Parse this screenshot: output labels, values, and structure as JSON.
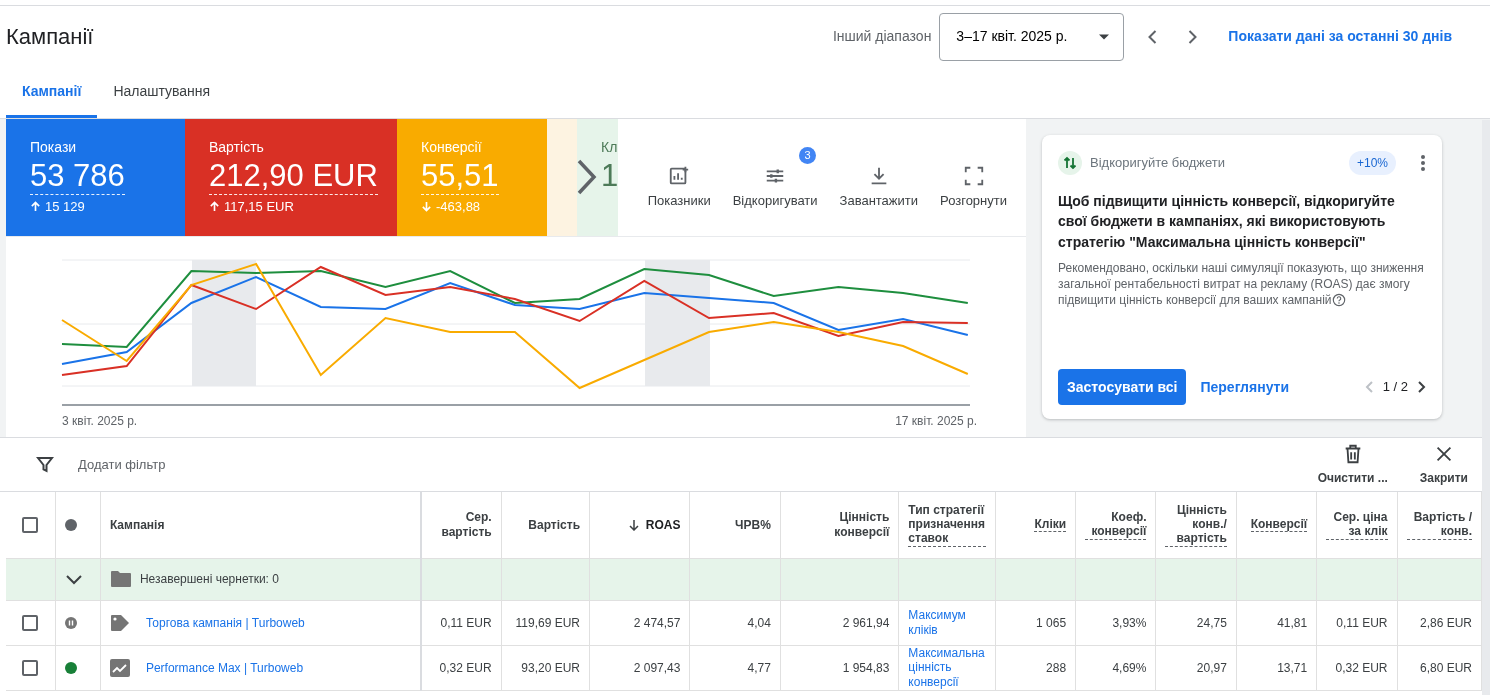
{
  "page_title": "Кампанії",
  "date_range": {
    "label": "Інший діапазон",
    "value": "3–17 квіт. 2025 р.",
    "last30_link": "Показати дані за останні 30 днів"
  },
  "tabs": [
    {
      "label": "Кампанії",
      "selected": true
    },
    {
      "label": "Налаштування",
      "selected": false
    }
  ],
  "metrics": [
    {
      "label": "Покази",
      "value": "53 786",
      "delta": "15 129",
      "increase": true,
      "color": "#1a73e8",
      "selected": true
    },
    {
      "label": "Вартість",
      "value": "212,90 EUR",
      "delta": "117,15 EUR",
      "increase": true,
      "color": "#d93025",
      "selected": true
    },
    {
      "label": "Конверсії",
      "value": "55,51",
      "delta": "-463,88",
      "increase": false,
      "color": "#f9ab00",
      "selected": true
    },
    {
      "label": "Кл",
      "value": "1",
      "selected": false
    }
  ],
  "toolbar": [
    {
      "kind": "metrics",
      "label": "Показники"
    },
    {
      "kind": "adjust",
      "label": "Відкоригувати",
      "badge": "3"
    },
    {
      "kind": "download",
      "label": "Завантажити"
    },
    {
      "kind": "expand",
      "label": "Розгорнути"
    }
  ],
  "chart": {
    "x_start": "3 квіт. 2025 р.",
    "x_end": "17 квіт. 2025 р."
  },
  "recommendation": {
    "title": "Відкоригуйте бюджети",
    "badge": "+10%",
    "heading": "Щоб підвищити цінність конверсії, відкоригуйте свої бюджети в кампаніях, які використовують стратегію \"Максимальна цінність конверсії\"",
    "body": "Рекомендовано, оскільки наші симуляції показують, що зниження загальної рентабельності витрат на рекламу (ROAS) дає змогу підвищити цінність конверсії для ваших кампаній",
    "apply": "Застосувати всі",
    "view": "Переглянути",
    "pager": "1 / 2"
  },
  "filter_bar": {
    "add_filter": "Додати фільтр",
    "clear": "Очистити ...",
    "close": "Закрити"
  },
  "table": {
    "header_checked": false,
    "columns": [
      {
        "label": "Кампанія",
        "underlined": false,
        "sorted": false,
        "kind": "name"
      },
      {
        "label": "Сер. вартість",
        "underlined": false,
        "sorted": false,
        "kind": "num"
      },
      {
        "label": "Вартість",
        "underlined": false,
        "sorted": false,
        "kind": "num"
      },
      {
        "label": "ROAS",
        "underlined": false,
        "sorted": true,
        "kind": "num"
      },
      {
        "label": "ЧРВ%",
        "underlined": false,
        "sorted": false,
        "kind": "num"
      },
      {
        "label": "Цінність конверсії",
        "underlined": false,
        "sorted": false,
        "kind": "num"
      },
      {
        "label": "Тип стратегії призначення ставок",
        "underlined": true,
        "sorted": false,
        "kind": "link"
      },
      {
        "label": "Кліки",
        "underlined": true,
        "sorted": false,
        "kind": "num"
      },
      {
        "label": "Коеф. конверсії",
        "underlined": true,
        "sorted": false,
        "kind": "num"
      },
      {
        "label": "Цінність конв./ вартість",
        "underlined": true,
        "sorted": false,
        "kind": "num"
      },
      {
        "label": "Конверсії",
        "underlined": true,
        "sorted": false,
        "kind": "num"
      },
      {
        "label": "Сер. ціна за клік",
        "underlined": true,
        "sorted": false,
        "kind": "num"
      },
      {
        "label": "Вартість / конв.",
        "underlined": true,
        "sorted": false,
        "kind": "num"
      }
    ],
    "rows": [
      {
        "kind": "group",
        "label": "Незавершені чернетки: 0",
        "expanded": true
      },
      {
        "kind": "shopping",
        "checked": false,
        "paused": true,
        "cells": [
          "Торгова кампанія | Turboweb",
          "0,11 EUR",
          "119,69 EUR",
          "2 474,57",
          "4,04",
          "2 961,94",
          "Максимум кліків",
          "1 065",
          "3,93%",
          "24,75",
          "41,81",
          "0,11 EUR",
          "2,86 EUR"
        ]
      },
      {
        "kind": "pmax",
        "checked": false,
        "paused": false,
        "cells": [
          "Performance Max | Turboweb",
          "0,32 EUR",
          "93,20 EUR",
          "2 097,43",
          "4,77",
          "1 954,83",
          "Максимальна цінність конверсії",
          "288",
          "4,69%",
          "20,97",
          "13,71",
          "0,32 EUR",
          "6,80 EUR"
        ]
      }
    ]
  }
}
